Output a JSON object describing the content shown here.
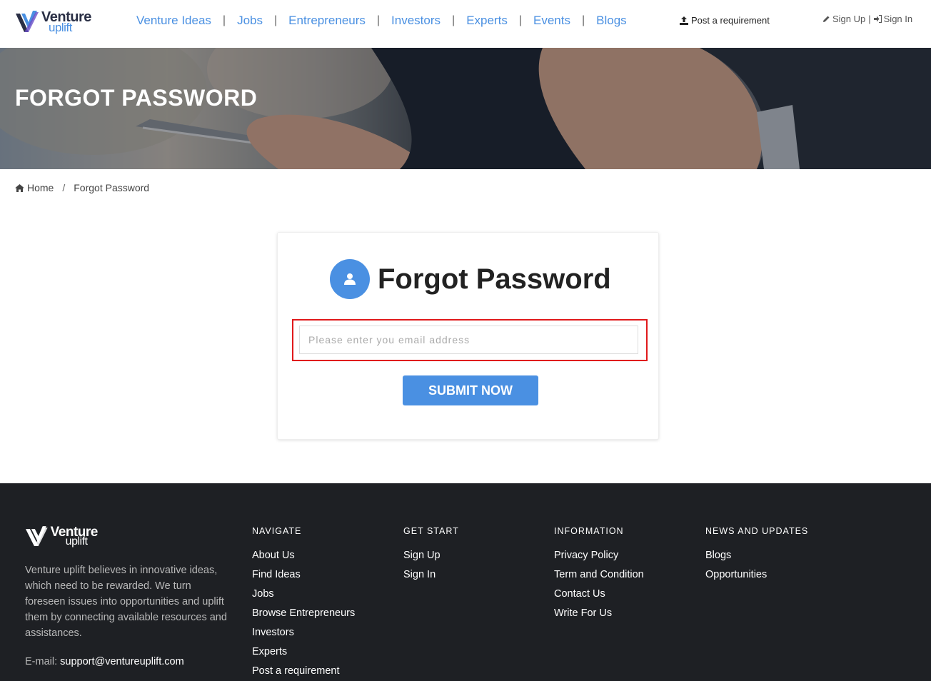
{
  "brand": {
    "word1": "Venture",
    "word2": "uplift"
  },
  "nav": {
    "items": [
      {
        "label": "Venture Ideas"
      },
      {
        "label": "Jobs"
      },
      {
        "label": "Entrepreneurs"
      },
      {
        "label": "Investors"
      },
      {
        "label": "Experts"
      },
      {
        "label": "Events"
      },
      {
        "label": "Blogs"
      }
    ],
    "separator": "|",
    "post_requirement": "Post a requirement",
    "sign_up": "Sign Up",
    "auth_separator": "|",
    "sign_in": "Sign In"
  },
  "banner": {
    "title": "FORGOT PASSWORD"
  },
  "breadcrumb": {
    "home": "Home",
    "separator": "/",
    "current": "Forgot Password"
  },
  "form": {
    "title": "Forgot Password",
    "email_placeholder": "Please enter you email address",
    "email_value": "",
    "submit_label": "SUBMIT NOW"
  },
  "footer": {
    "about": "Venture uplift believes in innovative ideas, which need to be rewarded. We turn foreseen issues into opportunities and uplift them by connecting available resources and assistances.",
    "email_label": "E-mail:",
    "email_value": "support@ventureuplift.com",
    "columns": [
      {
        "heading": "NAVIGATE",
        "links": [
          "About Us",
          "Find Ideas",
          "Jobs",
          "Browse Entrepreneurs",
          "Investors",
          "Experts",
          "Post a requirement"
        ]
      },
      {
        "heading": "GET START",
        "links": [
          "Sign Up",
          "Sign In"
        ]
      },
      {
        "heading": "INFORMATION",
        "links": [
          "Privacy Policy",
          "Term and Condition",
          "Contact Us",
          "Write For Us"
        ]
      },
      {
        "heading": "NEWS AND UPDATES",
        "links": [
          "Blogs",
          "Opportunities"
        ]
      }
    ]
  },
  "colors": {
    "accent": "#4a90e2",
    "highlight": "#e0191b",
    "footer_bg": "#1e2024"
  },
  "icons": [
    "logo-v-icon",
    "upload-icon",
    "pencil-icon",
    "sign-in-icon",
    "home-icon",
    "user-icon"
  ]
}
